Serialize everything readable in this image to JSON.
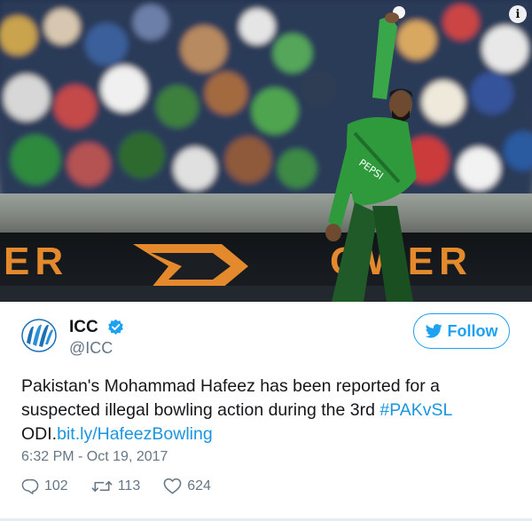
{
  "photo": {
    "board_left_text": "ER",
    "board_right_text": "OWER",
    "jersey_text": "PEPSI",
    "info_icon": "info-icon"
  },
  "tweet": {
    "author_name": "ICC",
    "author_handle": "@ICC",
    "verified_icon": "verified-badge-icon",
    "follow_label": "Follow",
    "follow_icon": "twitter-bird-icon",
    "text_plain": "Pakistan's Mohammad Hafeez has been reported for a suspected illegal bowling action during the 3rd ",
    "hashtag": "#PAKvSL",
    "text_after_hashtag": " ODI.",
    "link": "bit.ly/HafeezBowling",
    "timestamp": "6:32 PM - Oct 19, 2017",
    "reply_count": "102",
    "retweet_count": "113",
    "like_count": "624"
  },
  "colors": {
    "accent": "#1da1f2",
    "link": "#1b95e0",
    "muted": "#657786",
    "pakistan_green": "#2f9a3c"
  }
}
